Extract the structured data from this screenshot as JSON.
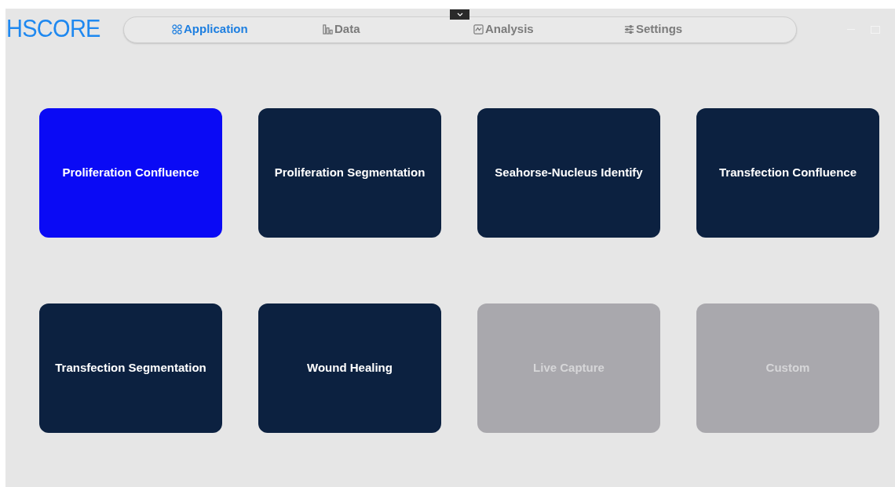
{
  "logo": "HSCORE",
  "tabs": [
    {
      "label": "Application",
      "selected": true
    },
    {
      "label": "Data",
      "selected": false
    },
    {
      "label": "Analysis",
      "selected": false
    },
    {
      "label": "Settings",
      "selected": false
    }
  ],
  "cards": [
    {
      "label": "Proliferation Confluence",
      "selected": true,
      "disabled": false
    },
    {
      "label": "Proliferation Segmentation",
      "selected": false,
      "disabled": false
    },
    {
      "label": "Seahorse-Nucleus Identify",
      "selected": false,
      "disabled": false
    },
    {
      "label": "Transfection Confluence",
      "selected": false,
      "disabled": false
    },
    {
      "label": "Transfection Segmentation",
      "selected": false,
      "disabled": false
    },
    {
      "label": "Wound Healing",
      "selected": false,
      "disabled": false
    },
    {
      "label": "Live Capture",
      "selected": false,
      "disabled": true
    },
    {
      "label": "Custom",
      "selected": false,
      "disabled": true
    }
  ]
}
